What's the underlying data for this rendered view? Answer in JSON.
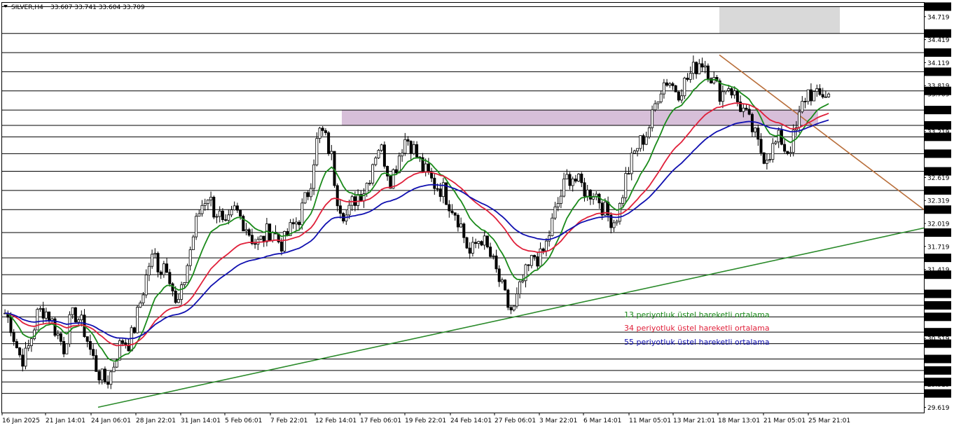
{
  "header": {
    "symbol": "SILVER,H4",
    "ohlc": "33.607 33.741 33.604 33.709"
  },
  "chart_data": {
    "type": "candlestick",
    "symbol": "SILVER",
    "timeframe": "H4",
    "ylim": [
      29.55,
      34.9
    ],
    "price_labels": [
      "34.850",
      "34.719",
      "34.500",
      "34.419",
      "34.250",
      "34.119",
      "34.000",
      "33.819",
      "33.750",
      "33.709",
      "33.500",
      "33.300",
      "33.219",
      "33.150",
      "32.930",
      "32.700",
      "32.619",
      "32.450",
      "32.319",
      "32.200",
      "32.019",
      "31.900",
      "31.719",
      "31.570",
      "31.419",
      "31.350",
      "31.100",
      "30.950",
      "30.800",
      "30.600",
      "30.519",
      "30.450",
      "30.250",
      "30.100",
      "29.950",
      "29.919",
      "29.800",
      "29.619"
    ],
    "price_values": [
      34.85,
      34.719,
      34.5,
      34.419,
      34.25,
      34.119,
      34.0,
      33.819,
      33.75,
      33.709,
      33.5,
      33.3,
      33.219,
      33.15,
      32.93,
      32.7,
      32.619,
      32.45,
      32.319,
      32.2,
      32.019,
      31.9,
      31.719,
      31.57,
      31.419,
      31.35,
      31.1,
      30.95,
      30.8,
      30.6,
      30.519,
      30.45,
      30.25,
      30.1,
      29.95,
      29.919,
      29.8,
      29.619
    ],
    "boxed_levels": [
      "34.850",
      "34.500",
      "34.250",
      "34.000",
      "33.750",
      "33.500",
      "33.300",
      "33.150",
      "32.930",
      "32.700",
      "32.450",
      "32.200",
      "31.900",
      "31.570",
      "31.350",
      "31.100",
      "30.950",
      "30.800",
      "30.600",
      "30.450",
      "30.250",
      "30.100",
      "29.950",
      "29.800"
    ],
    "horizontal_levels": [
      34.85,
      34.5,
      34.25,
      34.0,
      33.75,
      33.5,
      33.3,
      33.15,
      32.93,
      32.7,
      32.45,
      32.2,
      31.9,
      31.57,
      31.35,
      31.1,
      30.95,
      30.8,
      30.6,
      30.45,
      30.25,
      30.1,
      29.95,
      29.8
    ],
    "current_price": 33.709,
    "time_labels": [
      "16 Jan 2025",
      "21 Jan 14:01",
      "24 Jan 06:01",
      "28 Jan 22:01",
      "31 Jan 14:01",
      "5 Feb 06:01",
      "7 Feb 22:01",
      "12 Feb 14:01",
      "17 Feb 06:01",
      "19 Feb 22:01",
      "24 Feb 14:01",
      "27 Feb 06:01",
      "3 Mar 22:01",
      "6 Mar 14:01",
      "11 Mar 05:01",
      "13 Mar 21:01",
      "18 Mar 13:01",
      "21 Mar 05:01",
      "25 Mar 21:01"
    ],
    "zones": [
      {
        "name": "supply-zone",
        "from": 0.0,
        "to": 0.2,
        "y_top": 34.85,
        "y_bottom": 34.5,
        "color": "#d9d9d9"
      },
      {
        "name": "resistance-zone",
        "from": 0.0,
        "to": 0.4,
        "y_top": 33.5,
        "y_bottom": 33.3,
        "color": "#d7bfd9"
      }
    ],
    "trendlines": [
      {
        "name": "falling-resistance",
        "color": "#b86e3a",
        "from": [
          0.0,
          34.22
        ],
        "to": [
          1.0,
          32.2
        ]
      },
      {
        "name": "rising-support",
        "color": "#2a8a2a",
        "from": [
          0.0,
          29.62
        ],
        "to": [
          1.0,
          31.96
        ]
      }
    ],
    "series": [
      {
        "name": "13 periyotluk üstel hareketli ortalama",
        "color": "#1a8a1a",
        "period": 13
      },
      {
        "name": "34 periyotluk üstel hareketli ortalama",
        "color": "#e0203a",
        "period": 34
      },
      {
        "name": "55 periyotluk üstel hareketli ortalama",
        "color": "#1010b0",
        "period": 55
      }
    ],
    "legend_position": "bottom-right",
    "price_path": [
      30.85,
      30.72,
      30.45,
      30.25,
      30.3,
      30.55,
      30.82,
      30.9,
      30.85,
      30.7,
      30.55,
      30.4,
      30.7,
      30.85,
      30.75,
      30.6,
      30.35,
      30.15,
      30.0,
      29.95,
      30.1,
      30.35,
      30.5,
      30.45,
      30.6,
      30.9,
      31.2,
      31.5,
      31.6,
      31.4,
      31.55,
      31.3,
      30.9,
      31.1,
      31.45,
      31.8,
      32.1,
      32.3,
      32.4,
      32.2,
      32.15,
      31.9,
      32.05,
      32.2,
      32.1,
      32.0,
      31.85,
      31.75,
      31.8,
      31.9,
      31.95,
      31.8,
      31.75,
      31.9,
      32.0,
      32.1,
      32.3,
      32.5,
      33.0,
      33.25,
      33.1,
      32.9,
      32.4,
      32.2,
      32.1,
      32.3,
      32.4,
      32.45,
      32.6,
      32.9,
      33.05,
      32.85,
      32.6,
      32.75,
      33.0,
      33.15,
      33.05,
      32.9,
      32.75,
      32.65,
      32.55,
      32.5,
      32.45,
      32.3,
      32.2,
      32.05,
      31.8,
      31.6,
      31.75,
      31.85,
      31.7,
      31.55,
      31.35,
      31.15,
      30.95,
      30.85,
      31.1,
      31.3,
      31.45,
      31.6,
      31.55,
      31.7,
      31.95,
      32.2,
      32.4,
      32.6,
      32.65,
      32.55,
      32.5,
      32.4,
      32.45,
      32.35,
      32.2,
      32.1,
      32.05,
      32.25,
      32.6,
      32.8,
      33.0,
      33.1,
      33.2,
      33.4,
      33.7,
      33.85,
      33.9,
      33.8,
      33.75,
      33.85,
      33.95,
      34.05,
      34.15,
      34.1,
      33.95,
      33.8,
      33.7,
      33.85,
      33.75,
      33.6,
      33.5,
      33.35,
      33.2,
      33.0,
      32.9,
      32.95,
      33.05,
      33.15,
      32.95,
      33.05,
      33.25,
      33.55,
      33.75,
      33.7,
      33.65,
      33.72,
      33.709
    ]
  },
  "legend": {
    "ema13": "13 periyotluk üstel hareketli ortalama",
    "ema34": "34 periyotluk üstel hareketli ortalama",
    "ema55": "55 periyotluk üstel hareketli ortalama"
  }
}
